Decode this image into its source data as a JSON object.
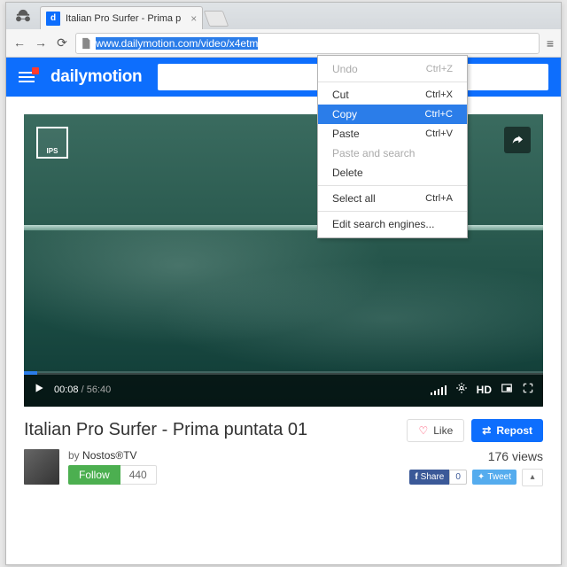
{
  "tab": {
    "title": "Italian Pro Surfer - Prima p",
    "favicon": "d"
  },
  "url": {
    "prefix": "",
    "selected": "www.dailymotion.com/video/x4etm"
  },
  "menu": {
    "items": [
      {
        "label": "Undo",
        "shortcut": "Ctrl+Z",
        "disabled": true
      },
      {
        "label": "Cut",
        "shortcut": "Ctrl+X"
      },
      {
        "label": "Copy",
        "shortcut": "Ctrl+C",
        "hl": true
      },
      {
        "label": "Paste",
        "shortcut": "Ctrl+V"
      },
      {
        "label": "Paste and search",
        "disabled": true
      },
      {
        "label": "Delete"
      }
    ],
    "items2": [
      {
        "label": "Select all",
        "shortcut": "Ctrl+A"
      }
    ],
    "items3": [
      {
        "label": "Edit search engines..."
      }
    ]
  },
  "brand": "dailymotion",
  "player": {
    "watermark": "IPS",
    "current": "00:08",
    "duration": "56:40",
    "hd": "HD"
  },
  "video": {
    "title": "Italian Pro Surfer - Prima puntata 01",
    "like": "Like",
    "repost": "Repost",
    "by": "by",
    "channel": "Nostos®TV",
    "follow": "Follow",
    "followers": "440",
    "views": "176 views",
    "fb_share": "Share",
    "fb_count": "0",
    "tweet": "Tweet"
  }
}
